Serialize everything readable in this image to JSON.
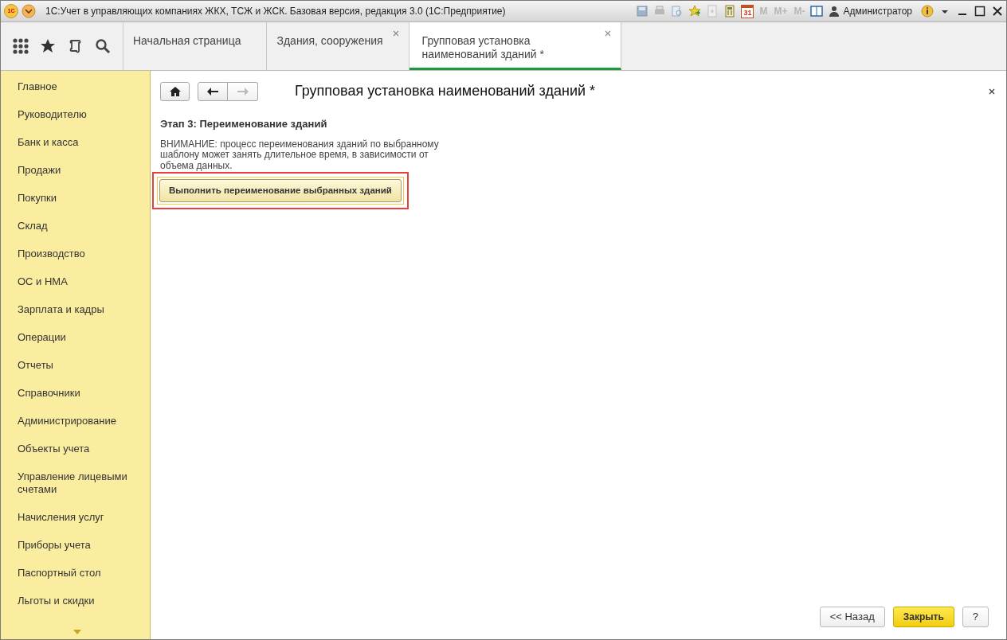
{
  "window": {
    "title": "1С:Учет в управляющих компаниях ЖКХ, ТСЖ и ЖСК. Базовая версия, редакция 3.0  (1С:Предприятие)",
    "logo": "1С",
    "calendar_day": "31",
    "memory_buttons": [
      "M",
      "M+",
      "M-"
    ],
    "user": "Администратор"
  },
  "tabs": [
    {
      "label": "Начальная страница",
      "selected": false,
      "closable": false
    },
    {
      "label": "Здания, сооружения",
      "selected": false,
      "closable": true
    },
    {
      "label": "Групповая установка наименований зданий *",
      "selected": true,
      "closable": true
    }
  ],
  "sidebar": {
    "items": [
      {
        "label": "Главное"
      },
      {
        "label": "Руководителю"
      },
      {
        "label": "Банк и касса"
      },
      {
        "label": "Продажи"
      },
      {
        "label": "Покупки"
      },
      {
        "label": "Склад"
      },
      {
        "label": "Производство"
      },
      {
        "label": "ОС и НМА"
      },
      {
        "label": "Зарплата и кадры"
      },
      {
        "label": "Операции"
      },
      {
        "label": "Отчеты"
      },
      {
        "label": "Справочники"
      },
      {
        "label": "Администрирование"
      },
      {
        "label": "Объекты учета"
      },
      {
        "label": "Управление лицевыми счетами"
      },
      {
        "label": "Начисления услуг"
      },
      {
        "label": "Приборы учета"
      },
      {
        "label": "Паспортный стол"
      },
      {
        "label": "Льготы и скидки"
      }
    ]
  },
  "form": {
    "title": "Групповая установка наименований зданий *",
    "step_heading": "Этап 3: Переименование зданий",
    "warning": "ВНИМАНИЕ: процесс переименования зданий по выбранному шаблону может занять длительное время, в зависимости от объема данных.",
    "action_button": {
      "label": "Выполнить переименование выбранных зданий",
      "highlighted": true
    }
  },
  "footer_buttons": [
    {
      "label": "<< Назад",
      "kind": "plain"
    },
    {
      "label": "Закрыть",
      "kind": "default"
    },
    {
      "label": "?",
      "kind": "plain"
    }
  ]
}
